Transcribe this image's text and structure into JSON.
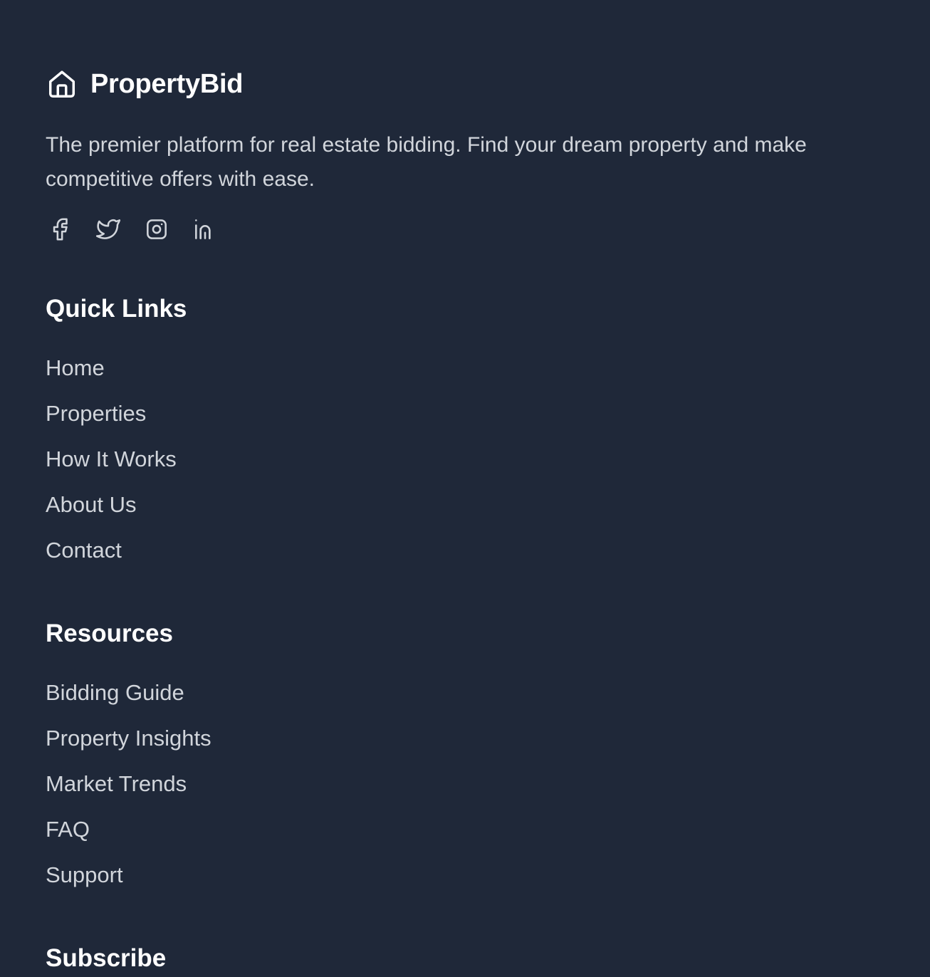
{
  "brand": {
    "name": "PropertyBid",
    "logo_icon": "home-icon",
    "tagline": "The premier platform for real estate bidding. Find your dream property and make competitive offers with ease."
  },
  "social": [
    {
      "name": "facebook",
      "icon": "facebook-icon"
    },
    {
      "name": "twitter",
      "icon": "twitter-icon"
    },
    {
      "name": "instagram",
      "icon": "instagram-icon"
    },
    {
      "name": "linkedin",
      "icon": "linkedin-icon"
    }
  ],
  "quick_links": {
    "title": "Quick Links",
    "items": [
      {
        "label": "Home"
      },
      {
        "label": "Properties"
      },
      {
        "label": "How It Works"
      },
      {
        "label": "About Us"
      },
      {
        "label": "Contact"
      }
    ]
  },
  "resources": {
    "title": "Resources",
    "items": [
      {
        "label": "Bidding Guide"
      },
      {
        "label": "Property Insights"
      },
      {
        "label": "Market Trends"
      },
      {
        "label": "FAQ"
      },
      {
        "label": "Support"
      }
    ]
  },
  "subscribe": {
    "title": "Subscribe"
  },
  "colors": {
    "background": "#1f2839",
    "heading": "#ffffff",
    "text": "#d1d5db"
  }
}
